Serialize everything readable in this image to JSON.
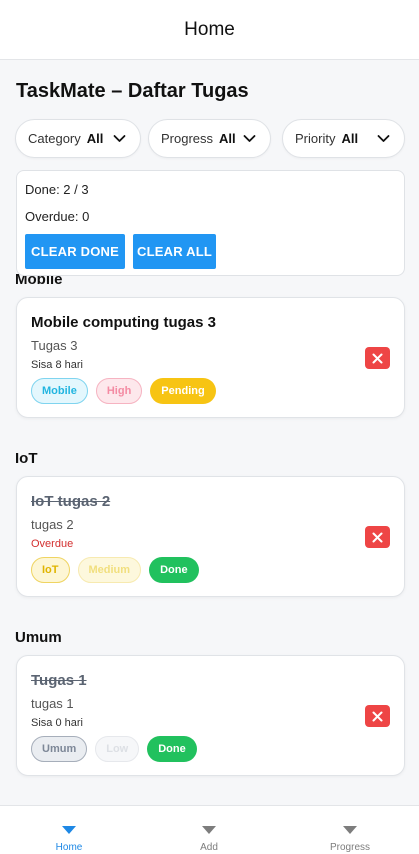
{
  "appbar": {
    "title": "Home"
  },
  "page": {
    "title": "TaskMate – Daftar Tugas"
  },
  "filters": [
    {
      "label": "Category",
      "value": "All"
    },
    {
      "label": "Progress",
      "value": "All"
    },
    {
      "label": "Priority",
      "value": "All"
    }
  ],
  "summary": {
    "done_text": "Done: 2 / 3",
    "overdue_text": "Overdue: 0",
    "clear_done_label": "CLEAR DONE",
    "clear_all_label": "CLEAR ALL"
  },
  "sections": [
    {
      "title": "Mobile",
      "tasks": [
        {
          "title": "Mobile computing tugas 3",
          "description": "Tugas 3",
          "due": "Sisa 8 hari",
          "category": "Mobile",
          "priority": "High",
          "status": "Pending"
        }
      ]
    },
    {
      "title": "IoT",
      "tasks": [
        {
          "title": "IoT tugas 2",
          "description": "tugas 2",
          "due": "Overdue",
          "category": "IoT",
          "priority": "Medium",
          "status": "Done"
        }
      ]
    },
    {
      "title": "Umum",
      "tasks": [
        {
          "title": "Tugas 1",
          "description": "tugas 1",
          "due": "Sisa 0 hari",
          "category": "Umum",
          "priority": "Low",
          "status": "Done"
        }
      ]
    }
  ],
  "bottom_nav": {
    "items": [
      {
        "label": "Home",
        "icon": "home-tab-icon",
        "active": true
      },
      {
        "label": "Add",
        "icon": "add-tab-icon",
        "active": false
      },
      {
        "label": "Progress",
        "icon": "progress-tab-icon",
        "active": false
      }
    ]
  },
  "colors": {
    "accent": "#2196f3",
    "active_tab": "#1e88e5",
    "delete": "#ee4545",
    "done": "#21c15e",
    "pending": "#f7c413",
    "overdue": "#d32f2f"
  }
}
